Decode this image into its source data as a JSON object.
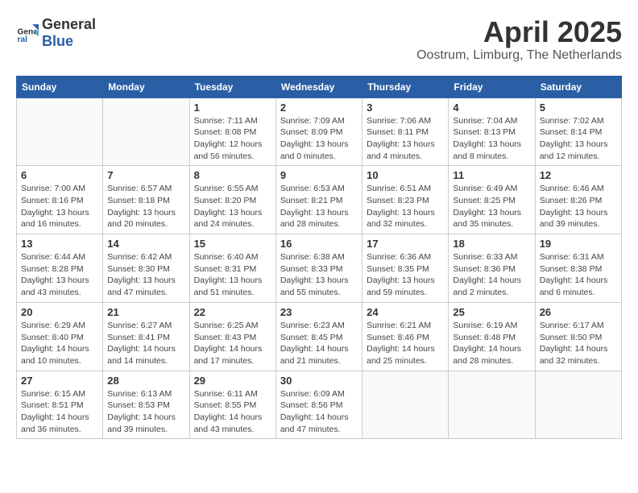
{
  "logo": {
    "general": "General",
    "blue": "Blue"
  },
  "title": "April 2025",
  "location": "Oostrum, Limburg, The Netherlands",
  "headers": [
    "Sunday",
    "Monday",
    "Tuesday",
    "Wednesday",
    "Thursday",
    "Friday",
    "Saturday"
  ],
  "weeks": [
    [
      {
        "day": "",
        "info": ""
      },
      {
        "day": "",
        "info": ""
      },
      {
        "day": "1",
        "info": "Sunrise: 7:11 AM\nSunset: 8:08 PM\nDaylight: 12 hours\nand 56 minutes."
      },
      {
        "day": "2",
        "info": "Sunrise: 7:09 AM\nSunset: 8:09 PM\nDaylight: 13 hours\nand 0 minutes."
      },
      {
        "day": "3",
        "info": "Sunrise: 7:06 AM\nSunset: 8:11 PM\nDaylight: 13 hours\nand 4 minutes."
      },
      {
        "day": "4",
        "info": "Sunrise: 7:04 AM\nSunset: 8:13 PM\nDaylight: 13 hours\nand 8 minutes."
      },
      {
        "day": "5",
        "info": "Sunrise: 7:02 AM\nSunset: 8:14 PM\nDaylight: 13 hours\nand 12 minutes."
      }
    ],
    [
      {
        "day": "6",
        "info": "Sunrise: 7:00 AM\nSunset: 8:16 PM\nDaylight: 13 hours\nand 16 minutes."
      },
      {
        "day": "7",
        "info": "Sunrise: 6:57 AM\nSunset: 8:18 PM\nDaylight: 13 hours\nand 20 minutes."
      },
      {
        "day": "8",
        "info": "Sunrise: 6:55 AM\nSunset: 8:20 PM\nDaylight: 13 hours\nand 24 minutes."
      },
      {
        "day": "9",
        "info": "Sunrise: 6:53 AM\nSunset: 8:21 PM\nDaylight: 13 hours\nand 28 minutes."
      },
      {
        "day": "10",
        "info": "Sunrise: 6:51 AM\nSunset: 8:23 PM\nDaylight: 13 hours\nand 32 minutes."
      },
      {
        "day": "11",
        "info": "Sunrise: 6:49 AM\nSunset: 8:25 PM\nDaylight: 13 hours\nand 35 minutes."
      },
      {
        "day": "12",
        "info": "Sunrise: 6:46 AM\nSunset: 8:26 PM\nDaylight: 13 hours\nand 39 minutes."
      }
    ],
    [
      {
        "day": "13",
        "info": "Sunrise: 6:44 AM\nSunset: 8:28 PM\nDaylight: 13 hours\nand 43 minutes."
      },
      {
        "day": "14",
        "info": "Sunrise: 6:42 AM\nSunset: 8:30 PM\nDaylight: 13 hours\nand 47 minutes."
      },
      {
        "day": "15",
        "info": "Sunrise: 6:40 AM\nSunset: 8:31 PM\nDaylight: 13 hours\nand 51 minutes."
      },
      {
        "day": "16",
        "info": "Sunrise: 6:38 AM\nSunset: 8:33 PM\nDaylight: 13 hours\nand 55 minutes."
      },
      {
        "day": "17",
        "info": "Sunrise: 6:36 AM\nSunset: 8:35 PM\nDaylight: 13 hours\nand 59 minutes."
      },
      {
        "day": "18",
        "info": "Sunrise: 6:33 AM\nSunset: 8:36 PM\nDaylight: 14 hours\nand 2 minutes."
      },
      {
        "day": "19",
        "info": "Sunrise: 6:31 AM\nSunset: 8:38 PM\nDaylight: 14 hours\nand 6 minutes."
      }
    ],
    [
      {
        "day": "20",
        "info": "Sunrise: 6:29 AM\nSunset: 8:40 PM\nDaylight: 14 hours\nand 10 minutes."
      },
      {
        "day": "21",
        "info": "Sunrise: 6:27 AM\nSunset: 8:41 PM\nDaylight: 14 hours\nand 14 minutes."
      },
      {
        "day": "22",
        "info": "Sunrise: 6:25 AM\nSunset: 8:43 PM\nDaylight: 14 hours\nand 17 minutes."
      },
      {
        "day": "23",
        "info": "Sunrise: 6:23 AM\nSunset: 8:45 PM\nDaylight: 14 hours\nand 21 minutes."
      },
      {
        "day": "24",
        "info": "Sunrise: 6:21 AM\nSunset: 8:46 PM\nDaylight: 14 hours\nand 25 minutes."
      },
      {
        "day": "25",
        "info": "Sunrise: 6:19 AM\nSunset: 8:48 PM\nDaylight: 14 hours\nand 28 minutes."
      },
      {
        "day": "26",
        "info": "Sunrise: 6:17 AM\nSunset: 8:50 PM\nDaylight: 14 hours\nand 32 minutes."
      }
    ],
    [
      {
        "day": "27",
        "info": "Sunrise: 6:15 AM\nSunset: 8:51 PM\nDaylight: 14 hours\nand 36 minutes."
      },
      {
        "day": "28",
        "info": "Sunrise: 6:13 AM\nSunset: 8:53 PM\nDaylight: 14 hours\nand 39 minutes."
      },
      {
        "day": "29",
        "info": "Sunrise: 6:11 AM\nSunset: 8:55 PM\nDaylight: 14 hours\nand 43 minutes."
      },
      {
        "day": "30",
        "info": "Sunrise: 6:09 AM\nSunset: 8:56 PM\nDaylight: 14 hours\nand 47 minutes."
      },
      {
        "day": "",
        "info": ""
      },
      {
        "day": "",
        "info": ""
      },
      {
        "day": "",
        "info": ""
      }
    ]
  ]
}
